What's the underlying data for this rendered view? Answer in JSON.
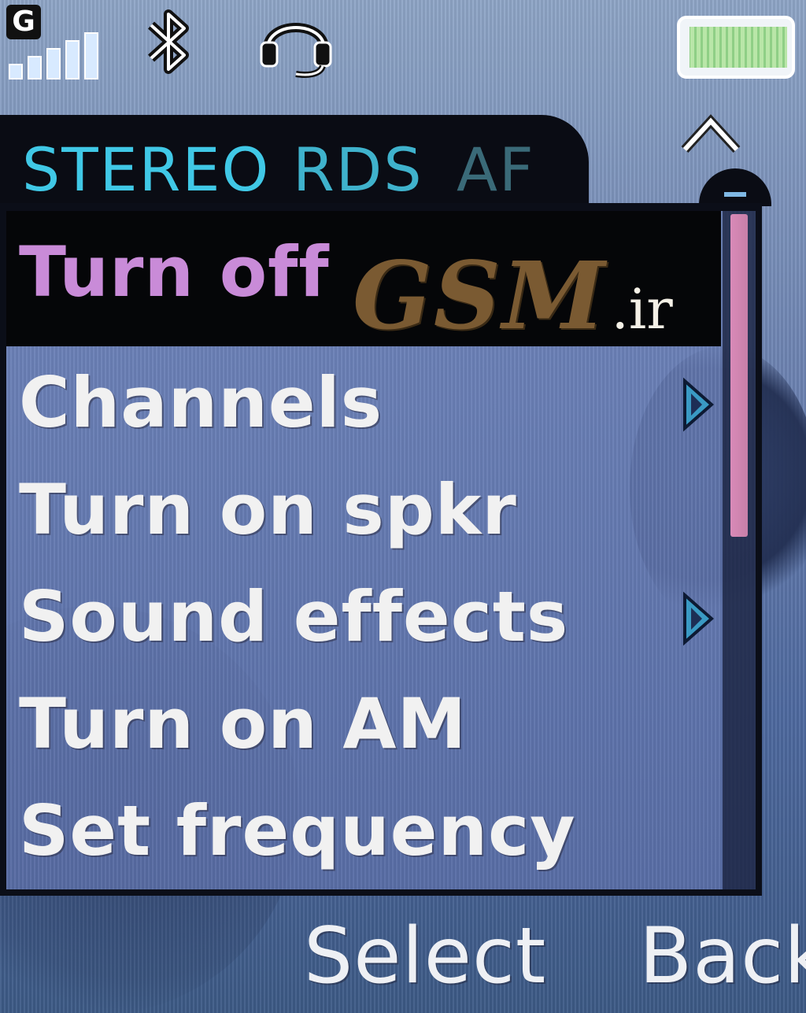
{
  "status_bar": {
    "network_letter": "G",
    "signal_bars": 5,
    "battery_level": 1.0
  },
  "radio_tabs": {
    "stereo": "STEREO",
    "rds": "RDS",
    "af": "AF"
  },
  "menu": {
    "items": [
      {
        "label": "Turn off",
        "selected": true,
        "submenu": false
      },
      {
        "label": "Channels",
        "selected": false,
        "submenu": true
      },
      {
        "label": "Turn on spkr",
        "selected": false,
        "submenu": false
      },
      {
        "label": "Sound effects",
        "selected": false,
        "submenu": true
      },
      {
        "label": "Turn on AM",
        "selected": false,
        "submenu": false
      },
      {
        "label": "Set frequency",
        "selected": false,
        "submenu": false
      }
    ]
  },
  "watermark": {
    "brand": "GSM",
    "tld": ".ir"
  },
  "softkeys": {
    "left": "Select",
    "right": "Back"
  },
  "colors": {
    "selected_text": "#c98bd8",
    "tab_active": "#40c8e6",
    "scroll_thumb": "#d98ab8"
  },
  "icons": [
    "network-g-icon",
    "signal-strength-icon",
    "bluetooth-icon",
    "headset-icon",
    "battery-icon",
    "scroll-up-icon",
    "submenu-arrow-icon"
  ]
}
